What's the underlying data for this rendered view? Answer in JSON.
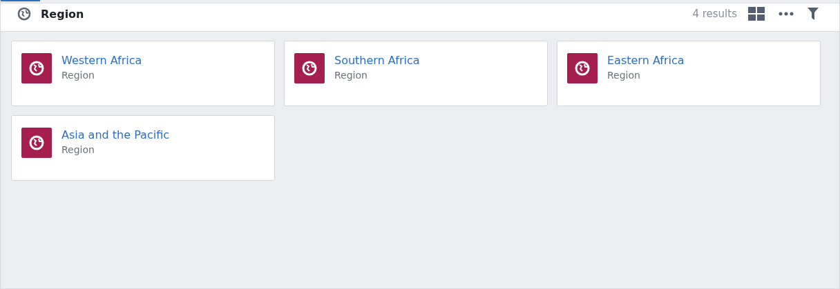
{
  "header": {
    "title": "Region",
    "result_count": "4 results"
  },
  "cards": [
    {
      "title": "Western Africa",
      "subtitle": "Region"
    },
    {
      "title": "Southern Africa",
      "subtitle": "Region"
    },
    {
      "title": "Eastern Africa",
      "subtitle": "Region"
    },
    {
      "title": "Asia and the Pacific",
      "subtitle": "Region"
    }
  ]
}
